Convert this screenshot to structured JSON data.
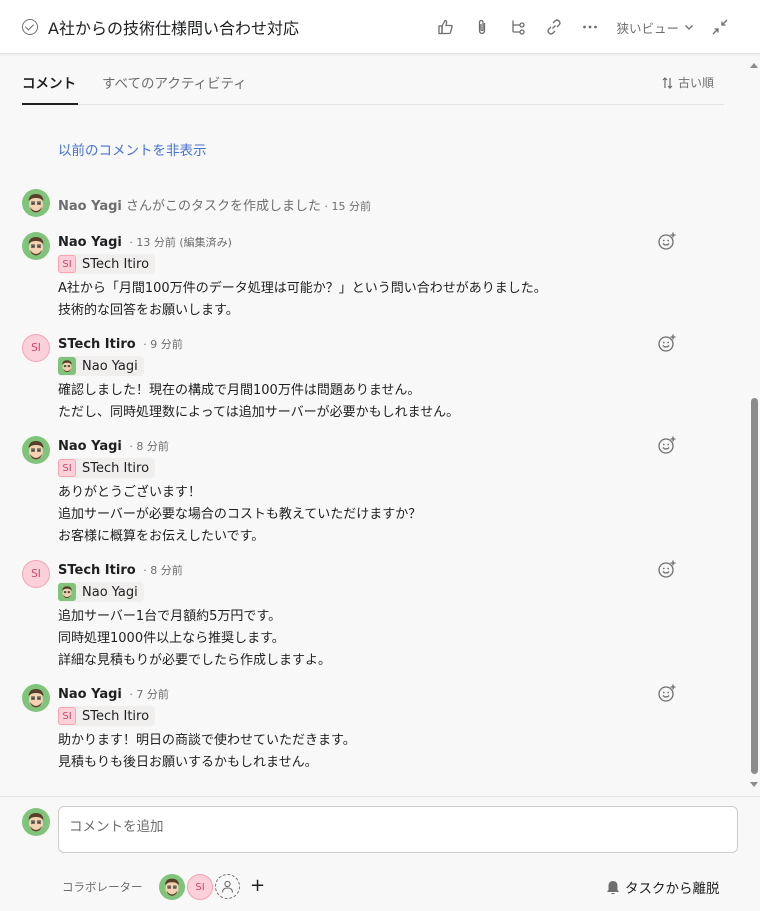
{
  "header": {
    "title": "A社からの技術仕様問い合わせ対応",
    "narrow_view_label": "狭いビュー"
  },
  "tabs": {
    "comments": "コメント",
    "all_activity": "すべてのアクティビティ"
  },
  "sort_label": "古い順",
  "hide_comments_link": "以前のコメントを非表示",
  "activity": {
    "author": "Nao Yagi",
    "text": " さんがこのタスクを作成しました",
    "time": " · 15 分前"
  },
  "comments": [
    {
      "author": "Nao Yagi",
      "meta": "· 13 分前 (編集済み)",
      "mention": "STech Itiro",
      "mention_initials": "SI",
      "lines": [
        "A社から「月間100万件のデータ処理は可能か？」という問い合わせがありました。",
        "技術的な回答をお願いします。"
      ]
    },
    {
      "author": "STech Itiro",
      "initials": "SI",
      "meta": "· 9 分前",
      "mention": "Nao Yagi",
      "lines": [
        "確認しました！現在の構成で月間100万件は問題ありません。",
        "ただし、同時処理数によっては追加サーバーが必要かもしれません。"
      ]
    },
    {
      "author": "Nao Yagi",
      "meta": "· 8 分前",
      "mention": "STech Itiro",
      "mention_initials": "SI",
      "lines": [
        "ありがとうございます！",
        "追加サーバーが必要な場合のコストも教えていただけますか？",
        "お客様に概算をお伝えしたいです。"
      ]
    },
    {
      "author": "STech Itiro",
      "initials": "SI",
      "meta": "· 8 分前",
      "mention": "Nao Yagi",
      "lines": [
        "追加サーバー1台で月額約5万円です。",
        "同時処理1000件以上なら推奨します。",
        "詳細な見積もりが必要でしたら作成しますよ。"
      ]
    },
    {
      "author": "Nao Yagi",
      "meta": "· 7 分前",
      "mention": "STech Itiro",
      "mention_initials": "SI",
      "lines": [
        "助かります！明日の商談で使わせていただきます。",
        "見積もりも後日お願いするかもしれません。"
      ]
    }
  ],
  "footer": {
    "comment_placeholder": "コメントを追加",
    "collaborators_label": "コラボレーター",
    "collaborator_initials": "SI",
    "leave_task_label": "タスクから離脱"
  },
  "colors": {
    "link": "#4573d2",
    "si_avatar_bg": "#fbd0d9",
    "nao_avatar_bg": "#7fc47a"
  }
}
